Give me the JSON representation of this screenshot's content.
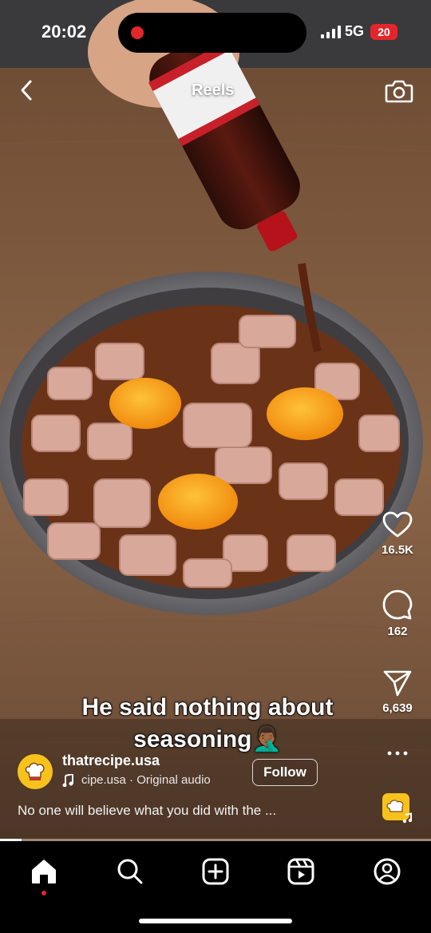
{
  "status_bar": {
    "time": "20:02",
    "network": "5G",
    "battery": "20"
  },
  "header": {
    "title": "Reels",
    "back_icon": "chevron-left-icon",
    "camera_icon": "camera-icon"
  },
  "video": {
    "caption_line1": "He said nothing about",
    "caption_line2": "seasoning",
    "caption_emoji": "🤦🏾‍♂️",
    "progress": 0.05
  },
  "actions": {
    "likes": "16.5K",
    "comments": "162",
    "shares": "6,639"
  },
  "author": {
    "username": "thatrecipe.usa",
    "audio": "cipe.usa · Original audio",
    "follow_label": "Follow",
    "description": "No one will believe what you did with the ..."
  },
  "bottom_nav": {
    "items": [
      "home-icon",
      "search-icon",
      "create-icon",
      "reels-icon",
      "profile-icon"
    ],
    "active": "home-icon"
  },
  "colors": {
    "accent": "#e3262c",
    "avatar_bg": "#f7c21c"
  }
}
